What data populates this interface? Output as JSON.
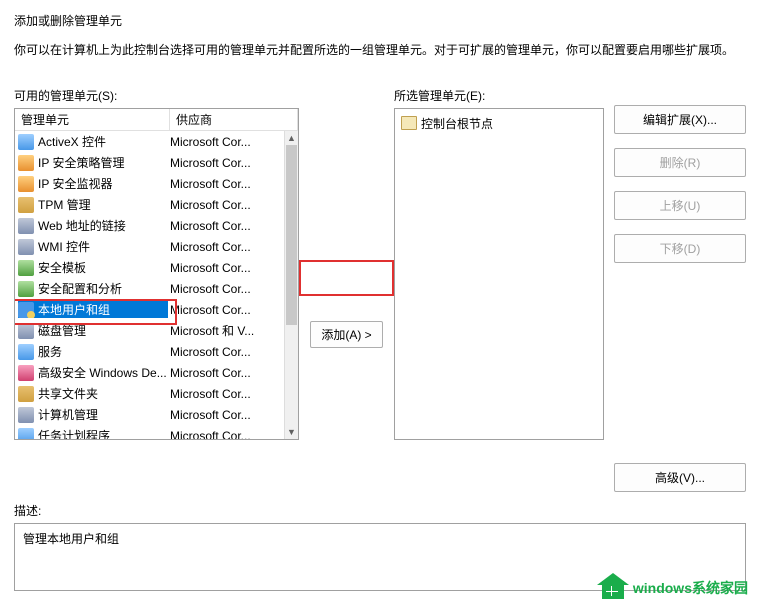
{
  "dialog": {
    "title": "添加或删除管理单元",
    "subtitle": "你可以在计算机上为此控制台选择可用的管理单元并配置所选的一组管理单元。对于可扩展的管理单元，你可以配置要启用哪些扩展项。"
  },
  "available": {
    "label": "可用的管理单元(S):",
    "headers": {
      "name": "管理单元",
      "vendor": "供应商"
    },
    "rows": [
      {
        "name": "ActiveX 控件",
        "vendor": "Microsoft Cor...",
        "icon": "ic2"
      },
      {
        "name": "IP 安全策略管理",
        "vendor": "Microsoft Cor...",
        "icon": "ic3"
      },
      {
        "name": "IP 安全监视器",
        "vendor": "Microsoft Cor...",
        "icon": "ic3"
      },
      {
        "name": "TPM 管理",
        "vendor": "Microsoft Cor...",
        "icon": "ic1"
      },
      {
        "name": "Web 地址的链接",
        "vendor": "Microsoft Cor...",
        "icon": "ic5"
      },
      {
        "name": "WMI 控件",
        "vendor": "Microsoft Cor...",
        "icon": "ic5"
      },
      {
        "name": "安全模板",
        "vendor": "Microsoft Cor...",
        "icon": "ic4"
      },
      {
        "name": "安全配置和分析",
        "vendor": "Microsoft Cor...",
        "icon": "ic4"
      },
      {
        "name": "本地用户和组",
        "vendor": "Microsoft Cor...",
        "icon": "ic7",
        "selected": true
      },
      {
        "name": "磁盘管理",
        "vendor": "Microsoft 和 V...",
        "icon": "ic5"
      },
      {
        "name": "服务",
        "vendor": "Microsoft Cor...",
        "icon": "ic2"
      },
      {
        "name": "高级安全 Windows De...",
        "vendor": "Microsoft Cor...",
        "icon": "ic6"
      },
      {
        "name": "共享文件夹",
        "vendor": "Microsoft Cor...",
        "icon": "ic1"
      },
      {
        "name": "计算机管理",
        "vendor": "Microsoft Cor...",
        "icon": "ic5"
      },
      {
        "name": "任务计划程序",
        "vendor": "Microsoft Cor...",
        "icon": "ic2"
      }
    ]
  },
  "selected_panel": {
    "label": "所选管理单元(E):",
    "root": "控制台根节点"
  },
  "buttons": {
    "add": "添加(A) >",
    "edit_ext": "编辑扩展(X)...",
    "remove": "删除(R)",
    "move_up": "上移(U)",
    "move_down": "下移(D)",
    "advanced": "高级(V)..."
  },
  "description": {
    "label": "描述:",
    "text": "管理本地用户和组"
  },
  "watermark": "windows系统家园"
}
